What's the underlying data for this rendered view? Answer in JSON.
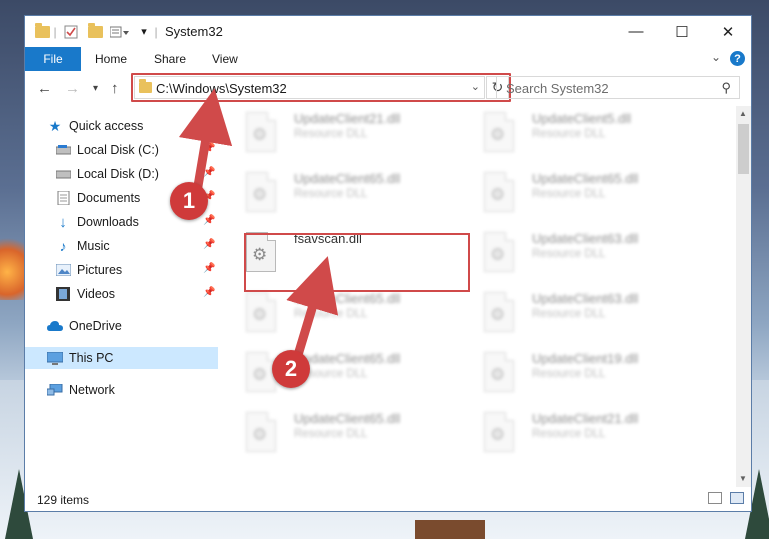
{
  "window": {
    "title": "System32"
  },
  "ribbon": {
    "tabs": [
      "File",
      "Home",
      "Share",
      "View"
    ],
    "help": "?"
  },
  "navbar": {
    "address": "C:\\Windows\\System32",
    "search_placeholder": "Search System32"
  },
  "sidebar": {
    "items": [
      {
        "label": "Quick access",
        "icon": "star-icon"
      },
      {
        "label": "Local Disk (C:)",
        "icon": "drive-icon",
        "pinned": true
      },
      {
        "label": "Local Disk (D:)",
        "icon": "drive-icon",
        "pinned": true
      },
      {
        "label": "Documents",
        "icon": "documents-icon",
        "pinned": true
      },
      {
        "label": "Downloads",
        "icon": "download-icon",
        "pinned": true
      },
      {
        "label": "Music",
        "icon": "music-icon",
        "pinned": true
      },
      {
        "label": "Pictures",
        "icon": "pictures-icon",
        "pinned": true
      },
      {
        "label": "Videos",
        "icon": "videos-icon",
        "pinned": true
      },
      {
        "label": "OneDrive",
        "icon": "cloud-icon"
      },
      {
        "label": "This PC",
        "icon": "computer-icon",
        "selected": true
      },
      {
        "label": "Network",
        "icon": "network-icon"
      }
    ]
  },
  "files": [
    {
      "name": "UpdateClient21.dll",
      "type": "Resource DLL",
      "blurred": true
    },
    {
      "name": "UpdateClient5.dll",
      "type": "Resource DLL",
      "blurred": true
    },
    {
      "name": "UpdateClient65.dll",
      "type": "Resource DLL",
      "blurred": true
    },
    {
      "name": "UpdateClient65.dll",
      "type": "Resource DLL",
      "blurred": true
    },
    {
      "name": "fsavscan.dll",
      "type": "",
      "blurred": false
    },
    {
      "name": "UpdateClient63.dll",
      "type": "Resource DLL",
      "blurred": true
    },
    {
      "name": "UpdateClient65.dll",
      "type": "Resource DLL",
      "blurred": true
    },
    {
      "name": "UpdateClient63.dll",
      "type": "Resource DLL",
      "blurred": true
    },
    {
      "name": "UpdateClient65.dll",
      "type": "Resource DLL",
      "blurred": true
    },
    {
      "name": "UpdateClient19.dll",
      "type": "Resource DLL",
      "blurred": true
    },
    {
      "name": "UpdateClient65.dll",
      "type": "Resource DLL",
      "blurred": true
    },
    {
      "name": "UpdateClient21.dll",
      "type": "Resource DLL",
      "blurred": true
    }
  ],
  "status": {
    "item_count": "129 items"
  },
  "annotations": {
    "step1": "1",
    "step2": "2",
    "color": "#d04a4a"
  }
}
